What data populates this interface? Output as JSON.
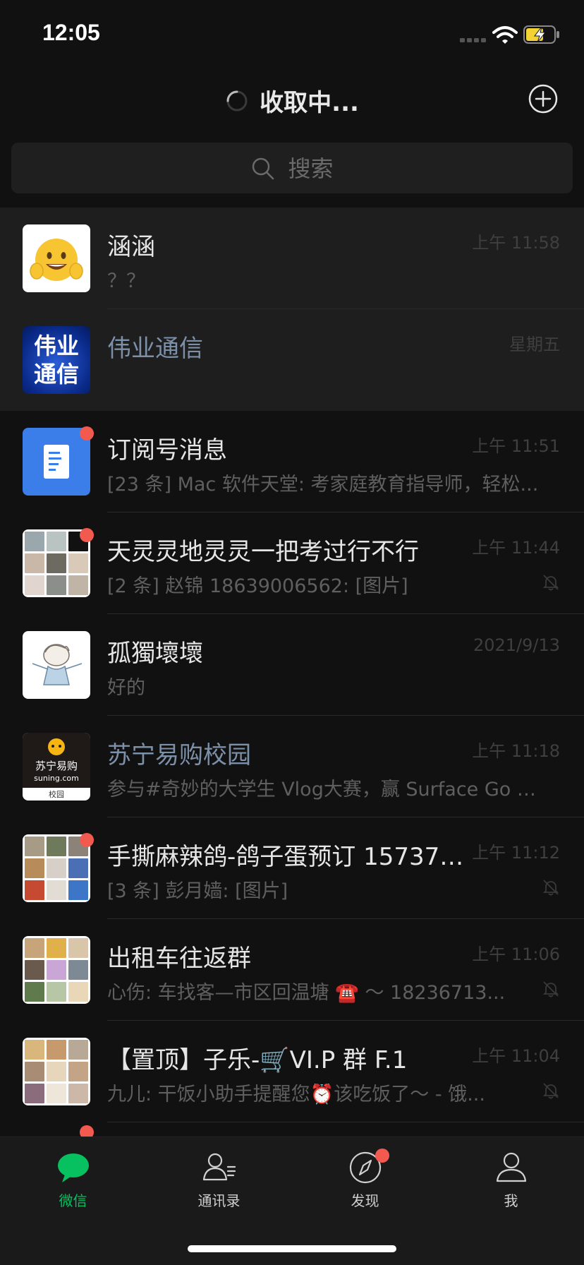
{
  "status_bar": {
    "time": "12:05"
  },
  "header": {
    "title": "收取中..."
  },
  "search": {
    "placeholder": "搜索"
  },
  "chats": [
    {
      "name": "涵涵",
      "preview": "？？",
      "time": "上午 11:58",
      "badge": false,
      "muted": false,
      "pinned": true,
      "official": false
    },
    {
      "name": "伟业通信",
      "preview": "",
      "time": "星期五",
      "badge": false,
      "muted": false,
      "pinned": true,
      "official": true,
      "avatar_text": [
        "伟业",
        "通信"
      ]
    },
    {
      "name": "订阅号消息",
      "preview": "[23 条] Mac 软件天堂: 考家庭教育指导师，轻松...",
      "time": "上午 11:51",
      "badge": true,
      "muted": false,
      "pinned": false,
      "official": false
    },
    {
      "name": "天灵灵地灵灵一把考过行不行",
      "preview": "[2 条] 赵锦 18639006562: [图片]",
      "time": "上午 11:44",
      "badge": true,
      "muted": true,
      "pinned": false,
      "official": false
    },
    {
      "name": "孤獨壞壞",
      "preview": "好的",
      "time": "2021/9/13",
      "badge": false,
      "muted": false,
      "pinned": false,
      "official": false
    },
    {
      "name": "苏宁易购校园",
      "preview": "参与#奇妙的大学生 Vlog大赛，赢 Surface Go 2...",
      "time": "上午 11:18",
      "badge": false,
      "muted": false,
      "pinned": false,
      "official": true,
      "avatar_text": [
        "苏宁易购",
        "suning.com",
        "校园"
      ]
    },
    {
      "name": "手撕麻辣鸽-鸽子蛋预订 157371...",
      "preview": "[3 条] 彭月嫱: [图片]",
      "time": "上午 11:12",
      "badge": true,
      "muted": true,
      "pinned": false,
      "official": false
    },
    {
      "name": "出租车往返群",
      "preview": "心伤: 车找客—市区回温塘 ☎️ ～ 18236713...",
      "time": "上午 11:06",
      "badge": false,
      "muted": true,
      "pinned": false,
      "official": false
    },
    {
      "name": "【置顶】子乐-🛒VI.P 群 F.1",
      "preview": "九儿: 干饭小助手提醒您⏰该吃饭了～ - 饿...",
      "time": "上午 11:04",
      "badge": false,
      "muted": true,
      "pinned": false,
      "official": false
    }
  ],
  "tabs": [
    {
      "label": "微信",
      "icon": "chat-bubble-icon",
      "active": true,
      "badge": false
    },
    {
      "label": "通讯录",
      "icon": "contacts-icon",
      "active": false,
      "badge": false
    },
    {
      "label": "发现",
      "icon": "compass-icon",
      "active": false,
      "badge": true
    },
    {
      "label": "我",
      "icon": "person-icon",
      "active": false,
      "badge": false
    }
  ],
  "colors": {
    "accent": "#07c160",
    "badge": "#f25a50",
    "official_name": "#7d90a9",
    "background": "#111111"
  }
}
